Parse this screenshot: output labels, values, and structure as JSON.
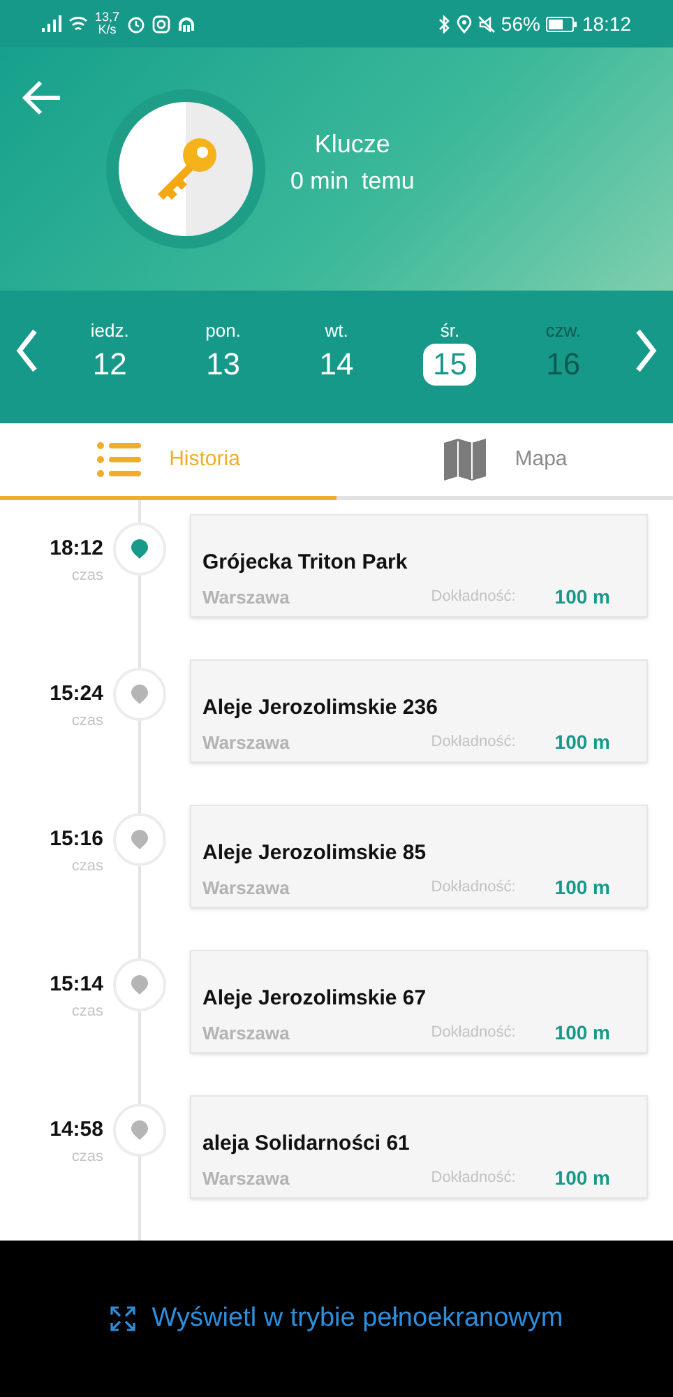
{
  "status_bar": {
    "speed_value": "13,7",
    "speed_unit": "K/s",
    "battery": "56%",
    "time": "18:12"
  },
  "header": {
    "title": "Klucze",
    "subtitle": "0 min  temu"
  },
  "days": [
    {
      "weekday": "iedz.",
      "date": "12",
      "selected": false,
      "disabled": false
    },
    {
      "weekday": "pon.",
      "date": "13",
      "selected": false,
      "disabled": false
    },
    {
      "weekday": "wt.",
      "date": "14",
      "selected": false,
      "disabled": false
    },
    {
      "weekday": "śr.",
      "date": "15",
      "selected": true,
      "disabled": false
    },
    {
      "weekday": "czw.",
      "date": "16",
      "selected": false,
      "disabled": true
    }
  ],
  "tabs": [
    {
      "label": "Historia",
      "kind": "list",
      "selected": true
    },
    {
      "label": "Mapa",
      "kind": "map",
      "selected": false
    }
  ],
  "entries": [
    {
      "time": "18:12",
      "time_label": "czas",
      "place": "Grójecka Triton Park",
      "city": "Warszawa",
      "accuracy_label": "Dokładność:",
      "accuracy": "100 m",
      "selected": true
    },
    {
      "time": "15:24",
      "time_label": "czas",
      "place": "Aleje Jerozolimskie 236",
      "city": "Warszawa",
      "accuracy_label": "Dokładność:",
      "accuracy": "100 m",
      "selected": false
    },
    {
      "time": "15:16",
      "time_label": "czas",
      "place": "Aleje Jerozolimskie 85",
      "city": "Warszawa",
      "accuracy_label": "Dokładność:",
      "accuracy": "100 m",
      "selected": false
    },
    {
      "time": "15:14",
      "time_label": "czas",
      "place": "Aleje Jerozolimskie 67",
      "city": "Warszawa",
      "accuracy_label": "Dokładność:",
      "accuracy": "100 m",
      "selected": false
    },
    {
      "time": "14:58",
      "time_label": "czas",
      "place": "aleja Solidarności 61",
      "city": "Warszawa",
      "accuracy_label": "Dokładność:",
      "accuracy": "100 m",
      "selected": false
    }
  ],
  "fullscreen_link": "Wyświetl w trybie pełnoekranowym"
}
